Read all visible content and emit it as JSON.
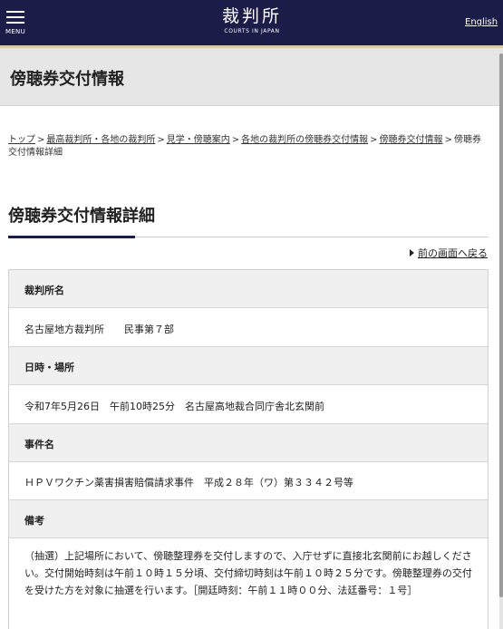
{
  "header": {
    "menu_label": "MENU",
    "logo_main": "裁判所",
    "logo_sub": "COURTS IN JAPAN",
    "lang_link": "English"
  },
  "page_title": "傍聴券交付情報",
  "breadcrumb": {
    "links": [
      "トップ",
      "最高裁判所・各地の裁判所",
      "見学・傍聴案内",
      "各地の裁判所の傍聴券交付情報",
      "傍聴券交付情報"
    ],
    "separator": ">",
    "current": "傍聴券交付情報詳細"
  },
  "detail_heading": "傍聴券交付情報詳細",
  "back_link": "前の画面へ戻る",
  "details": [
    {
      "label": "裁判所名",
      "value": "名古屋地方裁判所　　民事第７部"
    },
    {
      "label": "日時・場所",
      "value": "令和7年5月26日　午前10時25分　名古屋高地裁合同庁舎北玄関前"
    },
    {
      "label": "事件名",
      "value": "ＨＰＶワクチン薬害損害賠償請求事件　平成２８年（ワ）第３３４２号等"
    },
    {
      "label": "備考",
      "value": "（抽選）上記場所において、傍聴整理券を交付しますので、入庁せずに直接北玄関前にお越しください。交付開始時刻は午前１０時１５分頃、交付締切時刻は午前１０時２５分です。傍聴整理券の交付を受けた方を対象に抽選を行います。［開廷時刻：午前１１時００分、法廷番号：１号］"
    }
  ],
  "colors": {
    "header_bg": "#1c1c48",
    "header_rule": "#d7c9a5",
    "title_band": "#e6e6e6",
    "label_row": "#f0f0f0"
  }
}
